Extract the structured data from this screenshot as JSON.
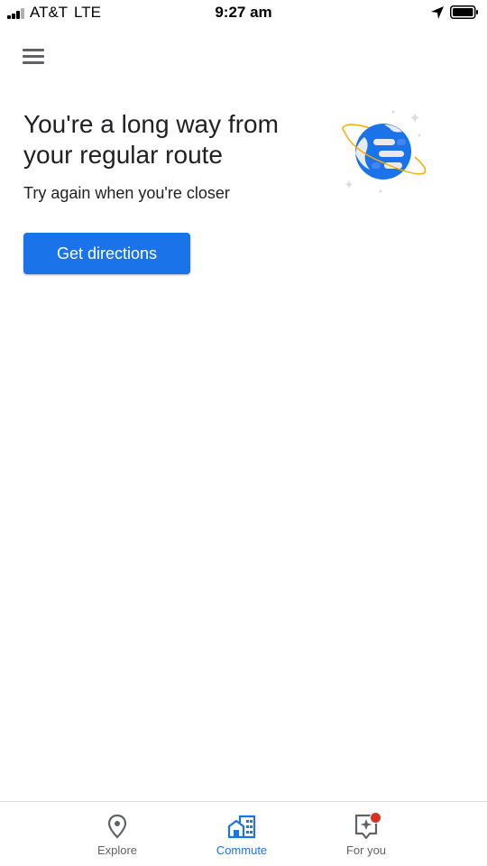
{
  "status_bar": {
    "carrier": "AT&T",
    "network": "LTE",
    "time": "9:27 am"
  },
  "header": {
    "menu_icon": "hamburger-menu-icon"
  },
  "main": {
    "headline": "You're a long way from your regular route",
    "subtext": "Try again when you're closer",
    "primary_button": "Get directions",
    "illustration": "planet-illustration"
  },
  "bottom_nav": {
    "items": [
      {
        "label": "Explore",
        "icon": "location-pin-icon",
        "active": false
      },
      {
        "label": "Commute",
        "icon": "commute-buildings-icon",
        "active": true
      },
      {
        "label": "For you",
        "icon": "for-you-sparkle-icon",
        "active": false,
        "badge": true
      }
    ]
  },
  "colors": {
    "accent": "#1a73e8",
    "text": "#202124",
    "inactive": "#5f6368",
    "badge": "#d93025"
  }
}
